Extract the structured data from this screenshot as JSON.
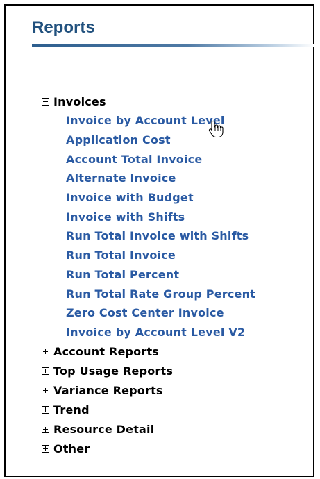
{
  "panel": {
    "title": "Reports"
  },
  "colors": {
    "title": "#21517e",
    "link": "#2a5aa3",
    "heading": "#000000"
  },
  "tree": {
    "invoices": {
      "label": "Invoices",
      "expanded": true,
      "items": [
        "Invoice by Account Level",
        "Application Cost",
        "Account Total Invoice",
        "Alternate Invoice",
        "Invoice with Budget",
        "Invoice with Shifts",
        "Run Total Invoice with Shifts",
        "Run Total Invoice",
        "Run Total Percent",
        "Run Total Rate Group Percent",
        "Zero Cost Center Invoice",
        "Invoice by Account Level V2"
      ]
    },
    "collapsed": [
      {
        "label": "Account Reports"
      },
      {
        "label": "Top Usage Reports"
      },
      {
        "label": "Variance Reports"
      },
      {
        "label": "Trend"
      },
      {
        "label": "Resource Detail"
      },
      {
        "label": "Other"
      }
    ]
  },
  "cursor": {
    "icon": "hand-pointer-icon"
  }
}
